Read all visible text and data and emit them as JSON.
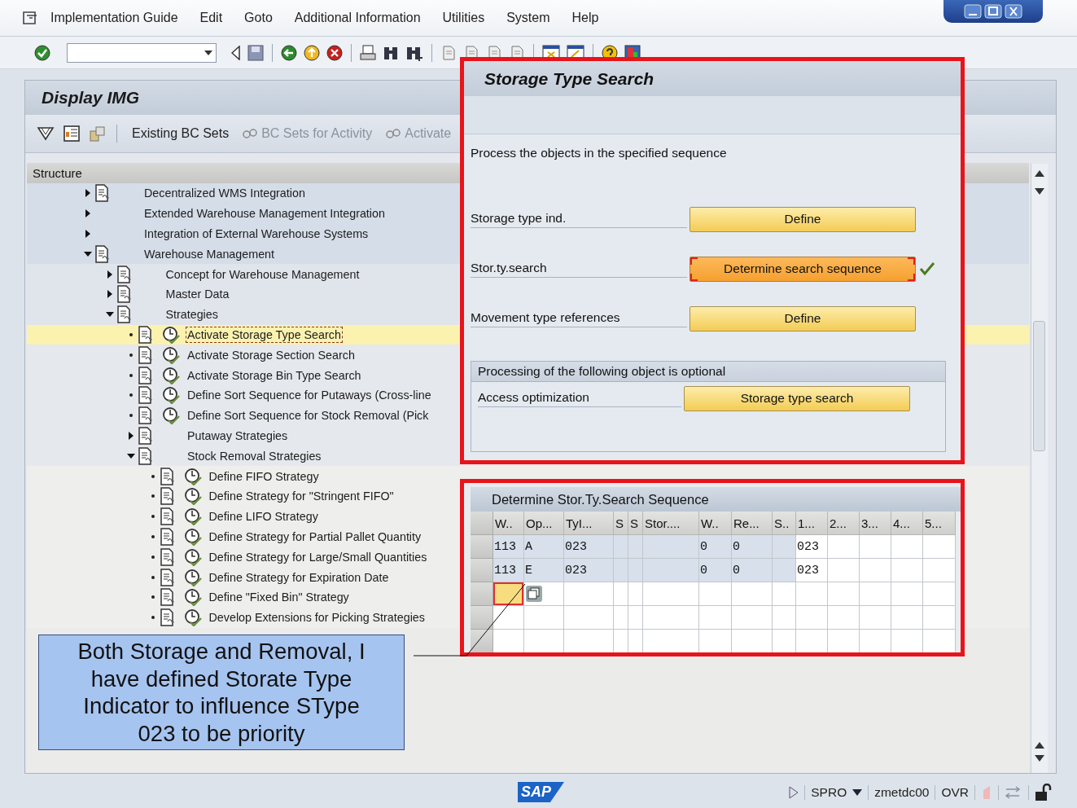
{
  "menubar": {
    "items": [
      "Implementation Guide",
      "Edit",
      "Goto",
      "Additional Information",
      "Utilities",
      "System",
      "Help"
    ]
  },
  "main": {
    "title": "Display IMG",
    "actions": [
      {
        "label": "Existing BC Sets",
        "disabled": false
      },
      {
        "label": "BC Sets for Activity",
        "disabled": true
      },
      {
        "label": "Activate",
        "disabled": true
      }
    ],
    "tree": {
      "header": "Structure",
      "nodes": [
        {
          "label": "Decentralized WMS Integration",
          "kind": "folder",
          "documented": true,
          "expanded": false,
          "selected": false
        },
        {
          "label": "Extended Warehouse Management Integration",
          "kind": "folder",
          "documented": false,
          "expanded": false,
          "selected": false
        },
        {
          "label": "Integration of External Warehouse Systems",
          "kind": "folder",
          "documented": false,
          "expanded": false,
          "selected": false
        },
        {
          "label": "Warehouse Management",
          "kind": "folder",
          "documented": true,
          "expanded": true,
          "selected": false,
          "children": [
            {
              "label": "Concept for Warehouse Management",
              "kind": "folder",
              "documented": true,
              "expanded": false,
              "selected": false
            },
            {
              "label": "Master Data",
              "kind": "folder",
              "documented": true,
              "expanded": false,
              "selected": false
            },
            {
              "label": "Strategies",
              "kind": "folder",
              "documented": true,
              "expanded": true,
              "selected": false,
              "children": [
                {
                  "label": "Activate Storage Type Search",
                  "kind": "activity",
                  "selected": true
                },
                {
                  "label": "Activate Storage Section Search",
                  "kind": "activity",
                  "selected": false
                },
                {
                  "label": "Activate Storage Bin Type Search",
                  "kind": "activity",
                  "selected": false
                },
                {
                  "label": "Define Sort Sequence for Putaways (Cross-line",
                  "kind": "activity",
                  "selected": false
                },
                {
                  "label": "Define Sort Sequence for Stock Removal (Pick",
                  "kind": "activity",
                  "selected": false
                },
                {
                  "label": "Putaway Strategies",
                  "kind": "folder",
                  "documented": true,
                  "expanded": false,
                  "selected": false
                },
                {
                  "label": "Stock Removal Strategies",
                  "kind": "folder",
                  "documented": true,
                  "expanded": true,
                  "selected": false,
                  "children": [
                    {
                      "label": "Define FIFO Strategy",
                      "kind": "activity",
                      "selected": false
                    },
                    {
                      "label": "Define Strategy for \"Stringent FIFO\"",
                      "kind": "activity",
                      "selected": false
                    },
                    {
                      "label": "Define LIFO Strategy",
                      "kind": "activity",
                      "selected": false
                    },
                    {
                      "label": "Define Strategy for Partial Pallet Quantity",
                      "kind": "activity",
                      "selected": false
                    },
                    {
                      "label": "Define Strategy for Large/Small Quantities",
                      "kind": "activity",
                      "selected": false
                    },
                    {
                      "label": "Define Strategy for Expiration Date",
                      "kind": "activity",
                      "selected": false
                    },
                    {
                      "label": "Define \"Fixed Bin\" Strategy",
                      "kind": "activity",
                      "selected": false
                    },
                    {
                      "label": "Develop Extensions for Picking Strategies",
                      "kind": "activity",
                      "selected": false
                    }
                  ]
                }
              ]
            }
          ]
        }
      ]
    }
  },
  "dialog": {
    "title": "Storage Type Search",
    "instruction": "Process the objects in the specified sequence",
    "steps": [
      {
        "label": "Storage type ind.",
        "button": "Define",
        "done": false,
        "focused": false
      },
      {
        "label": "Stor.ty.search",
        "button": "Determine search sequence",
        "done": true,
        "focused": true
      },
      {
        "label": "Movement type references",
        "button": "Define",
        "done": false,
        "focused": false
      }
    ],
    "optional_group": {
      "title": "Processing of the following object is optional",
      "steps": [
        {
          "label": "Access optimization",
          "button": "Storage type search",
          "done": false,
          "focused": false
        }
      ]
    }
  },
  "table": {
    "title": "Determine Stor.Ty.Search Sequence",
    "columns": [
      "W..",
      "Op...",
      "TyI...",
      "S",
      "S",
      "Stor....",
      "W..",
      "Re...",
      "S..",
      "1...",
      "2...",
      "3...",
      "4...",
      "5..."
    ],
    "rows": [
      {
        "cells": [
          "113",
          "A",
          "023",
          null,
          null,
          null,
          "0",
          "0",
          null,
          "023",
          null,
          null,
          null,
          null
        ]
      },
      {
        "cells": [
          "113",
          "E",
          "023",
          null,
          null,
          null,
          "0",
          "0",
          null,
          "023",
          null,
          null,
          null,
          null
        ]
      }
    ],
    "entry_row": {
      "focused": true
    }
  },
  "callout": {
    "text": "Both Storage and Removal, I have defined Storate Type Indicator to influence SType 023 to be priority"
  },
  "status": {
    "logo": "SAP",
    "transaction": "SPRO",
    "server": "zmetdc00",
    "mode": "OVR"
  }
}
